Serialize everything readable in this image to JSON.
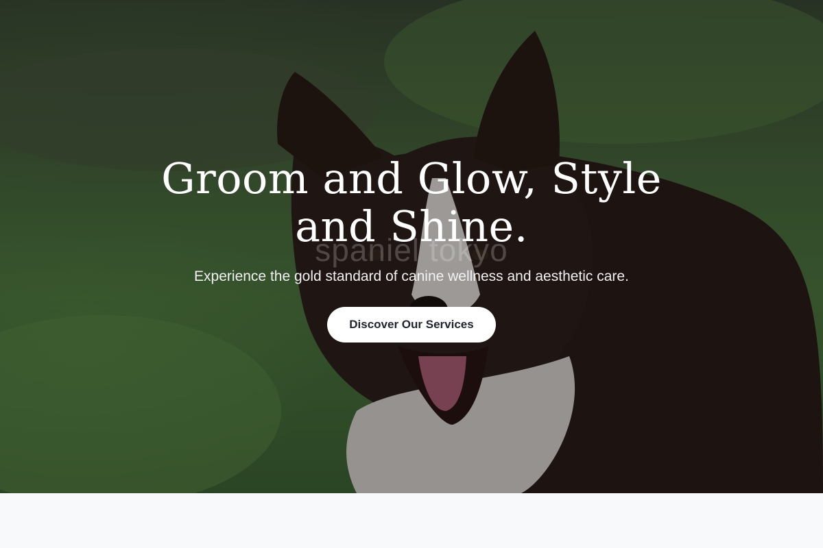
{
  "hero": {
    "watermark": "spaniel tokyo",
    "title": "Groom and Glow, Style and Shine.",
    "subtitle": "Experience the gold standard of canine wellness and aesthetic care.",
    "cta_label": "Discover Our Services"
  },
  "colors": {
    "cta_background": "#ffffff",
    "cta_text": "#1e2230",
    "page_background": "#f8f9fb"
  }
}
